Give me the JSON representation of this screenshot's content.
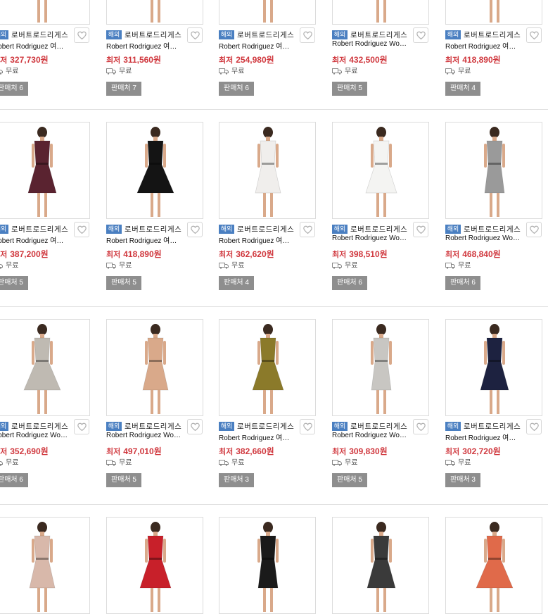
{
  "labels": {
    "overseas_badge": "해외",
    "store": "로버트로드리게스",
    "lowest": "최저",
    "shipping": "무료",
    "seller_prefix": "판매처"
  },
  "rows": [
    {
      "cards": [
        {
          "name": "Robert Rodriguez 여…",
          "price": "327,730원",
          "sellers": "6",
          "dress_color": "#c9a27c"
        },
        {
          "name": "Robert Rodriguez 여…",
          "price": "311,560원",
          "sellers": "7",
          "dress_color": "#d8b49a"
        },
        {
          "name": "Robert Rodriguez 여…",
          "price": "254,980원",
          "sellers": "6",
          "dress_color": "#1a1a1a"
        },
        {
          "name": "Robert Rodriguez Wo…",
          "price": "432,500원",
          "sellers": "5",
          "dress_color": "#b8906b"
        },
        {
          "name": "Robert Rodriguez 여…",
          "price": "418,890원",
          "sellers": "4",
          "dress_color": "#c99e7d"
        }
      ]
    },
    {
      "cards": [
        {
          "name": "Robert Rodriguez 여…",
          "price": "387,200원",
          "sellers": "5",
          "dress_color": "#5a2330"
        },
        {
          "name": "Robert Rodriguez 여…",
          "price": "418,890원",
          "sellers": "5",
          "dress_color": "#141414"
        },
        {
          "name": "Robert Rodriguez 여…",
          "price": "362,620원",
          "sellers": "4",
          "dress_color": "#f0eeec"
        },
        {
          "name": "Robert Rodriguez Wo…",
          "price": "398,510원",
          "sellers": "6",
          "dress_color": "#f4f4f2"
        },
        {
          "name": "Robert Rodriguez Wo…",
          "price": "468,840원",
          "sellers": "6",
          "dress_color": "#9a9a9a"
        }
      ]
    },
    {
      "cards": [
        {
          "name": "Robert Rodriguez Wo…",
          "price": "352,690원",
          "sellers": "6",
          "dress_color": "#bfbab2"
        },
        {
          "name": "Robert Rodriguez Wo…",
          "price": "497,010원",
          "sellers": "5",
          "dress_color": "#d9a98a"
        },
        {
          "name": "Robert Rodriguez 여…",
          "price": "382,660원",
          "sellers": "3",
          "dress_color": "#8b7a2a"
        },
        {
          "name": "Robert Rodriguez Wo…",
          "price": "309,830원",
          "sellers": "5",
          "dress_color": "#c8c6c2"
        },
        {
          "name": "Robert Rodriguez 여…",
          "price": "302,720원",
          "sellers": "3",
          "dress_color": "#1d2240"
        }
      ]
    },
    {
      "cards": [
        {
          "dress_color": "#d8b8aa"
        },
        {
          "dress_color": "#c8202a"
        },
        {
          "dress_color": "#1a1a1a"
        },
        {
          "dress_color": "#3a3a3a"
        },
        {
          "dress_color": "#e06a4a"
        }
      ]
    }
  ],
  "colors": {
    "badge": "#4a7fc1",
    "price": "#d0383e",
    "seller_button": "#8e8e8e"
  }
}
